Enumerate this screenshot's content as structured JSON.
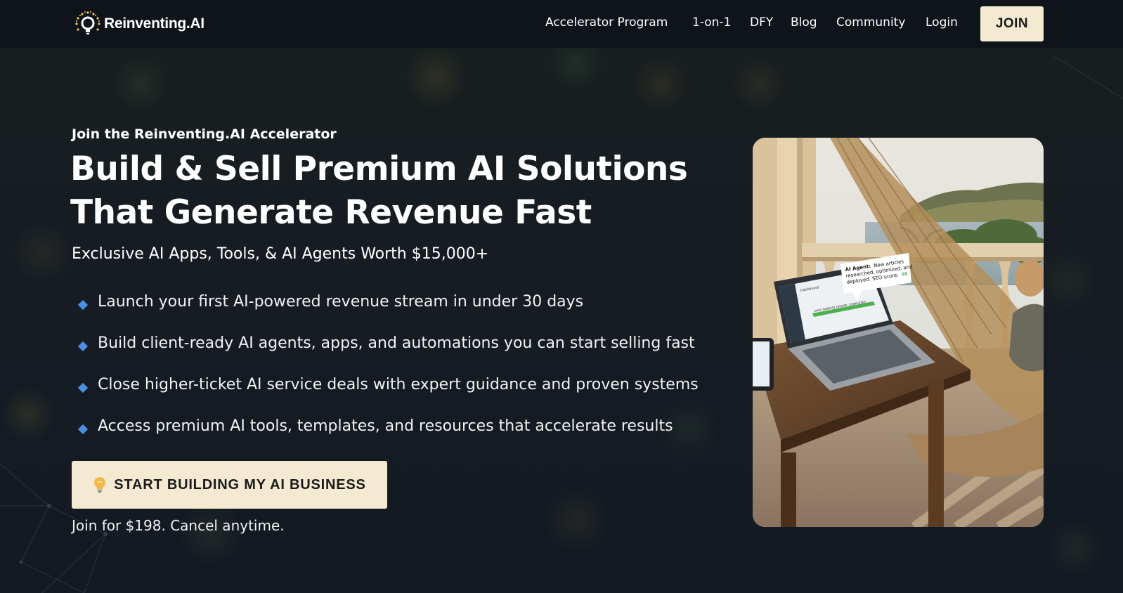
{
  "nav": {
    "brand": "Reinventing.AI",
    "links": [
      {
        "label": "Accelerator Program"
      },
      {
        "label": "1-on-1"
      },
      {
        "label": "DFY"
      },
      {
        "label": "Blog"
      },
      {
        "label": "Community"
      },
      {
        "label": "Login"
      }
    ],
    "join_label": "JOIN"
  },
  "hero": {
    "eyebrow": "Join the Reinventing.AI Accelerator",
    "headline_line1": "Build & Sell Premium AI Solutions",
    "headline_line2": "That Generate Revenue Fast",
    "subhead": "Exclusive AI Apps, Tools, & AI Agents Worth $15,000+",
    "bullets": [
      "Launch your first AI-powered revenue stream in under 30 days",
      "Build client-ready AI agents, apps, and automations you can start selling fast",
      "Close higher-ticket AI service deals with expert guidance and proven systems",
      "Access premium AI tools, templates, and resources that accelerate results"
    ],
    "cta_label": "START BUILDING MY AI BUSINESS",
    "price_note": "Join for $198. Cancel anytime."
  },
  "image": {
    "bubble_prefix": "AI Agent:",
    "bubble_text_1": "New articles",
    "bubble_text_2": "researched, optimized, and",
    "bubble_text_3": "deployed. SEO score:",
    "bubble_score": "98.",
    "screen_title": "Dashboard",
    "screen_status": "DAILY WEBSITE UPDATE: COMPLETED"
  },
  "colors": {
    "accent_cream": "#f4ead2",
    "bullet_blue": "#4a90e2",
    "nav_bg": "#0f141b"
  },
  "icons": [
    "sun-logo-icon",
    "diamond-bullet-icon",
    "lightbulb-icon"
  ]
}
